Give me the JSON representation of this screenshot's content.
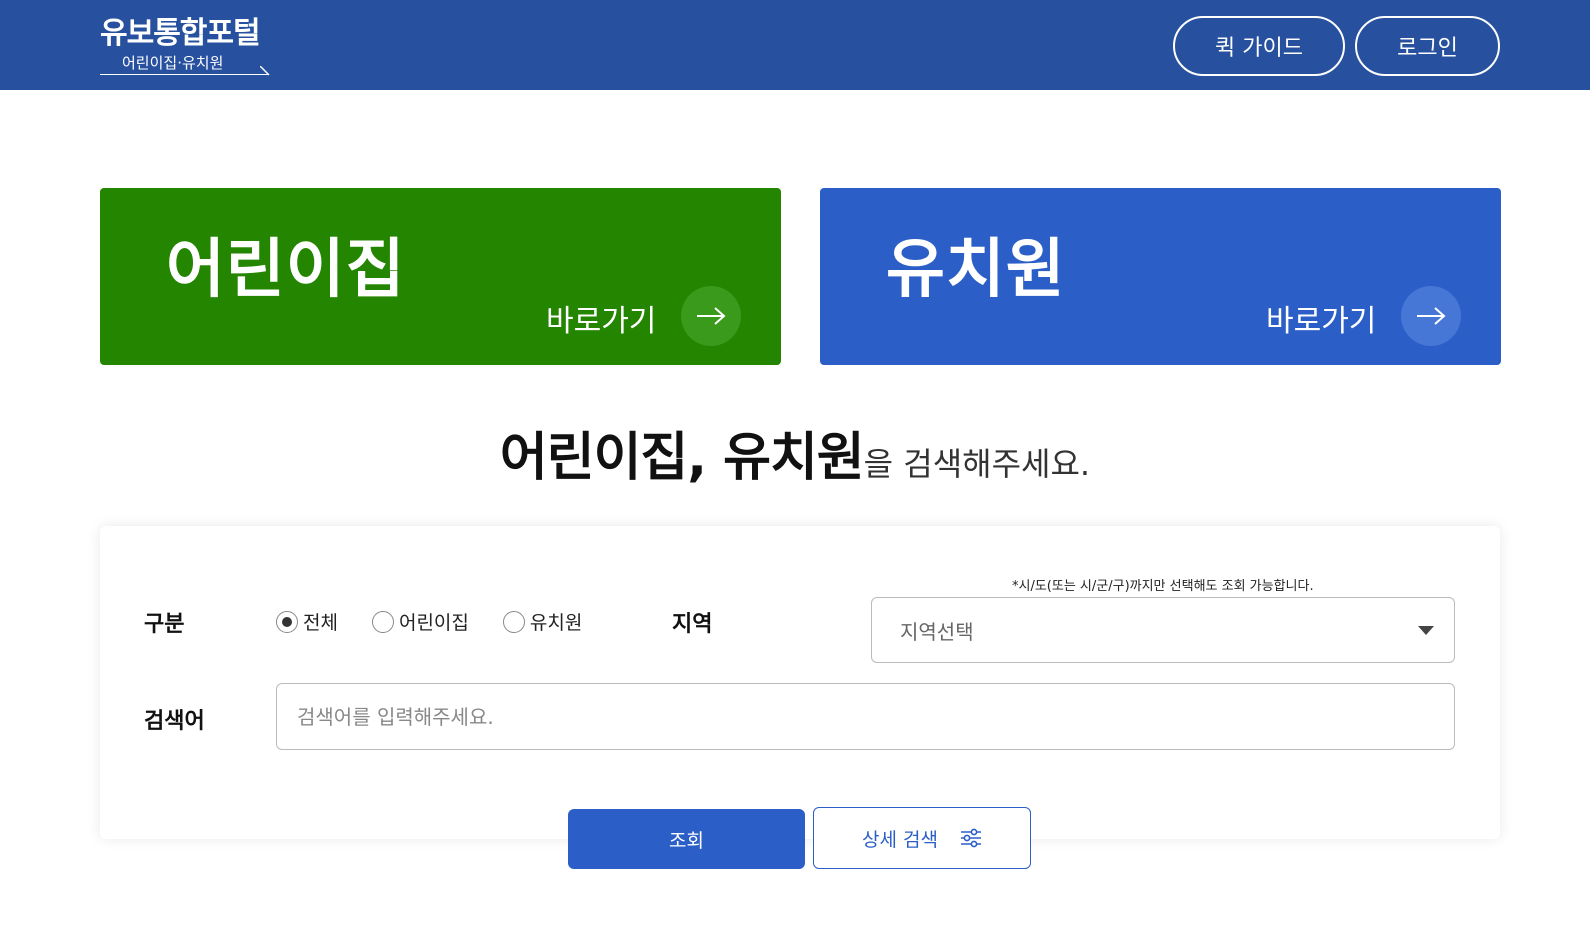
{
  "header": {
    "logo_title": "유보통합포털",
    "logo_subtitle": "어린이집·유치원",
    "quick_guide_label": "퀵 가이드",
    "login_label": "로그인",
    "background_color": "#27519f"
  },
  "banners": [
    {
      "title": "어린이집",
      "go_label": "바로가기",
      "icon": "arrow-right-icon",
      "color": "#238500"
    },
    {
      "title": "유치원",
      "go_label": "바로가기",
      "icon": "arrow-right-icon",
      "color": "#2b5fc7"
    }
  ],
  "headline": {
    "strong": "어린이집, 유치원",
    "rest": "을 검색해주세요."
  },
  "search": {
    "type_label": "구분",
    "type_options": [
      "전체",
      "어린이집",
      "유치원"
    ],
    "type_selected": "전체",
    "region_label": "지역",
    "region_note": "*시/도(또는 시/군/구)까지만 선택해도 조회 가능합니다.",
    "region_select_value": "지역선택",
    "keyword_label": "검색어",
    "keyword_placeholder": "검색어를 입력해주세요.",
    "keyword_value": "",
    "submit_label": "조회",
    "detail_label": "상세 검색",
    "detail_icon": "filter-sliders-icon",
    "accent_color": "#2b5fc7"
  }
}
